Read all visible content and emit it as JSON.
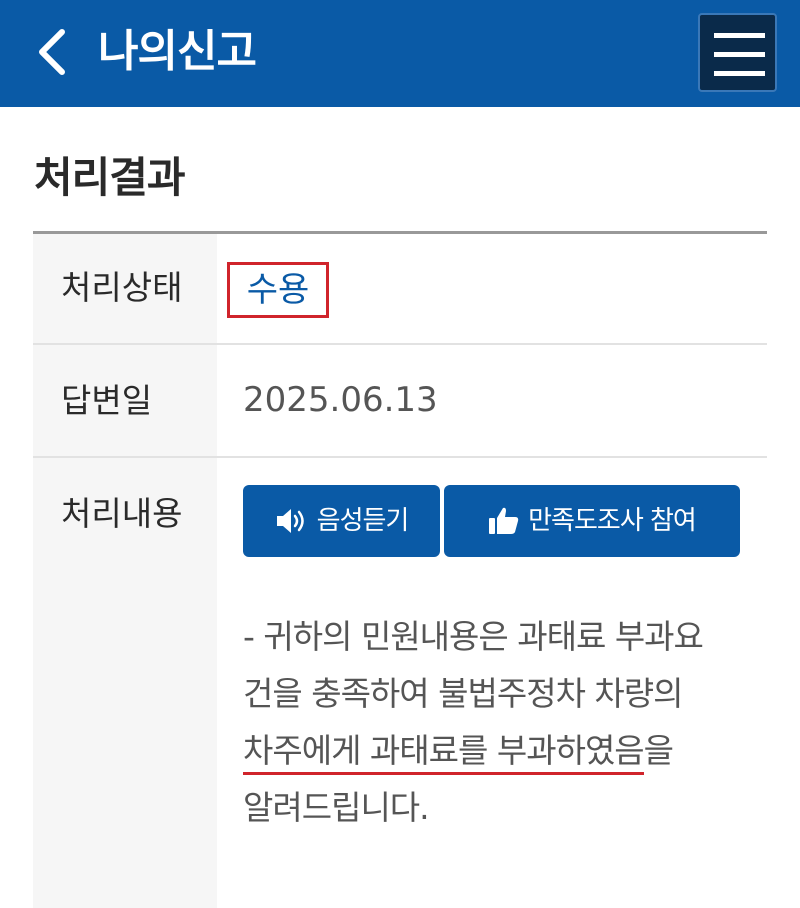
{
  "header": {
    "title": "나의신고",
    "back_icon": "back-arrow-icon",
    "menu_icon": "hamburger-menu-icon",
    "color": "#0a5aa6"
  },
  "section": {
    "title": "처리결과"
  },
  "result": {
    "status_label": "처리상태",
    "status_value": "수용",
    "date_label": "답변일",
    "date_value": "2025.06.13",
    "content_label": "처리내용",
    "buttons": {
      "voice": "음성듣기",
      "survey": "만족도조사 참여"
    },
    "content_lines": [
      "- 귀하의 민원내용은 과태료 부과요",
      "건을 충족하여 불법주정차 차량의",
      "차주에게 과태료를 부과하였음",
      "을",
      "알려드립니다."
    ]
  },
  "colors": {
    "accent": "#0a5aa6",
    "highlight": "#d0242b"
  }
}
